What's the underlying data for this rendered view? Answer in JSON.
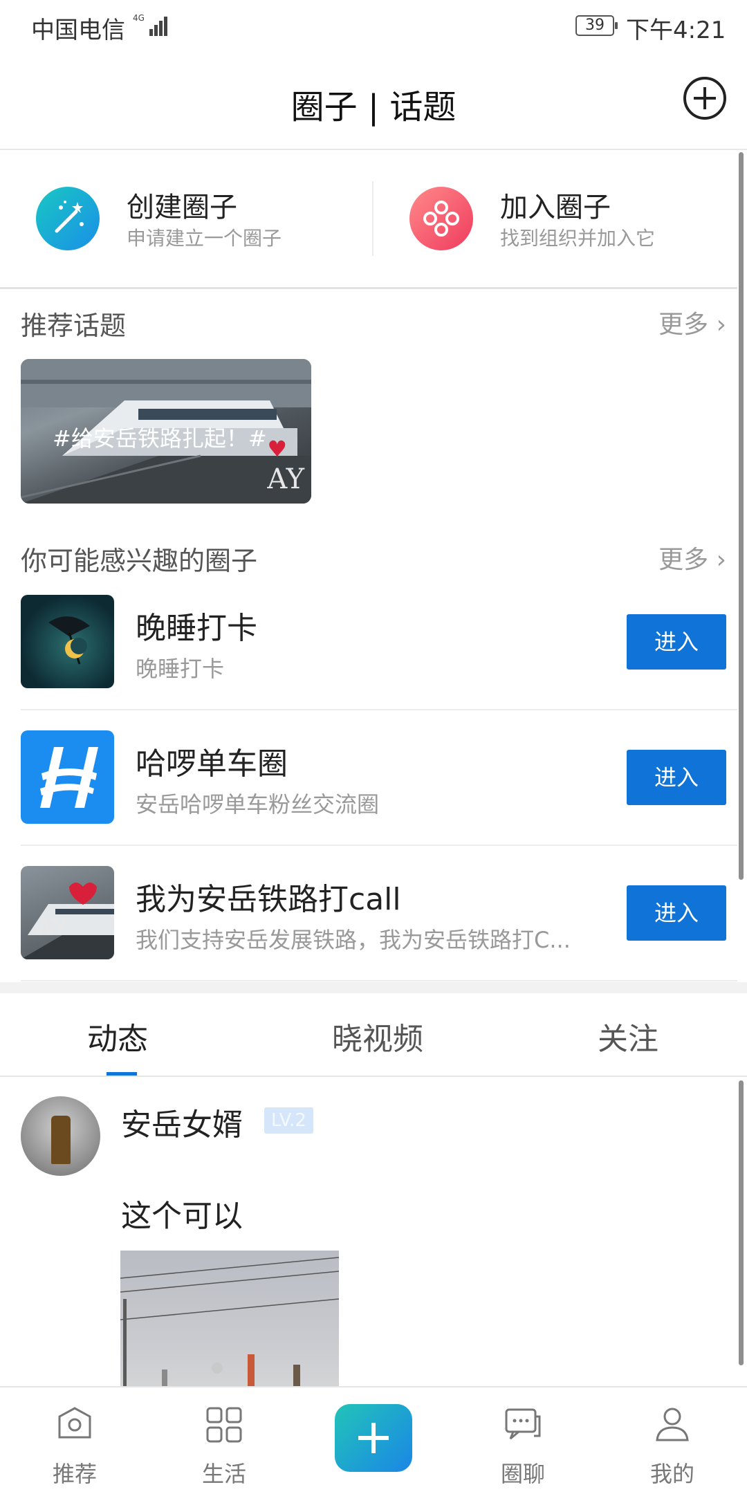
{
  "status_bar": {
    "carrier": "中国电信",
    "network": "4G",
    "battery": "39",
    "time": "下午4:21"
  },
  "header": {
    "title": "圈子 | 话题"
  },
  "actions": {
    "create": {
      "label": "创建圈子",
      "sub": "申请建立一个圈子",
      "icon": "magic-wand-icon"
    },
    "join": {
      "label": "加入圈子",
      "sub": "找到组织并加入它",
      "icon": "group-dots-icon"
    }
  },
  "topics": {
    "heading": "推荐话题",
    "more": "更多",
    "card": {
      "text": "#给安岳铁路扎起！#",
      "logo": "AY"
    }
  },
  "circles": {
    "heading": "你可能感兴趣的圈子",
    "more": "更多",
    "enter_label": "进入",
    "items": [
      {
        "name": "晚睡打卡",
        "desc": "晚睡打卡"
      },
      {
        "name": "哈啰单车圈",
        "desc": "安岳哈啰单车粉丝交流圈"
      },
      {
        "name": "我为安岳铁路打call",
        "desc": "我们支持安岳发展铁路，我为安岳铁路打C..."
      }
    ]
  },
  "tabs": {
    "items": [
      {
        "label": "动态"
      },
      {
        "label": "晓视频"
      },
      {
        "label": "关注"
      }
    ],
    "active": "动态"
  },
  "post": {
    "user": "安岳女婿",
    "level": "LV.2",
    "text": "这个可以"
  },
  "bottom_nav": {
    "items": [
      {
        "label": "推荐",
        "icon": "home-icon"
      },
      {
        "label": "生活",
        "icon": "grid-icon"
      },
      {
        "label": "",
        "icon": "plus-icon"
      },
      {
        "label": "圈聊",
        "icon": "chat-icon"
      },
      {
        "label": "我的",
        "icon": "profile-icon"
      }
    ]
  },
  "colors": {
    "accent": "#0f73d8",
    "create_gradient": "#19c7c2",
    "join_gradient": "#ef3b5e"
  }
}
